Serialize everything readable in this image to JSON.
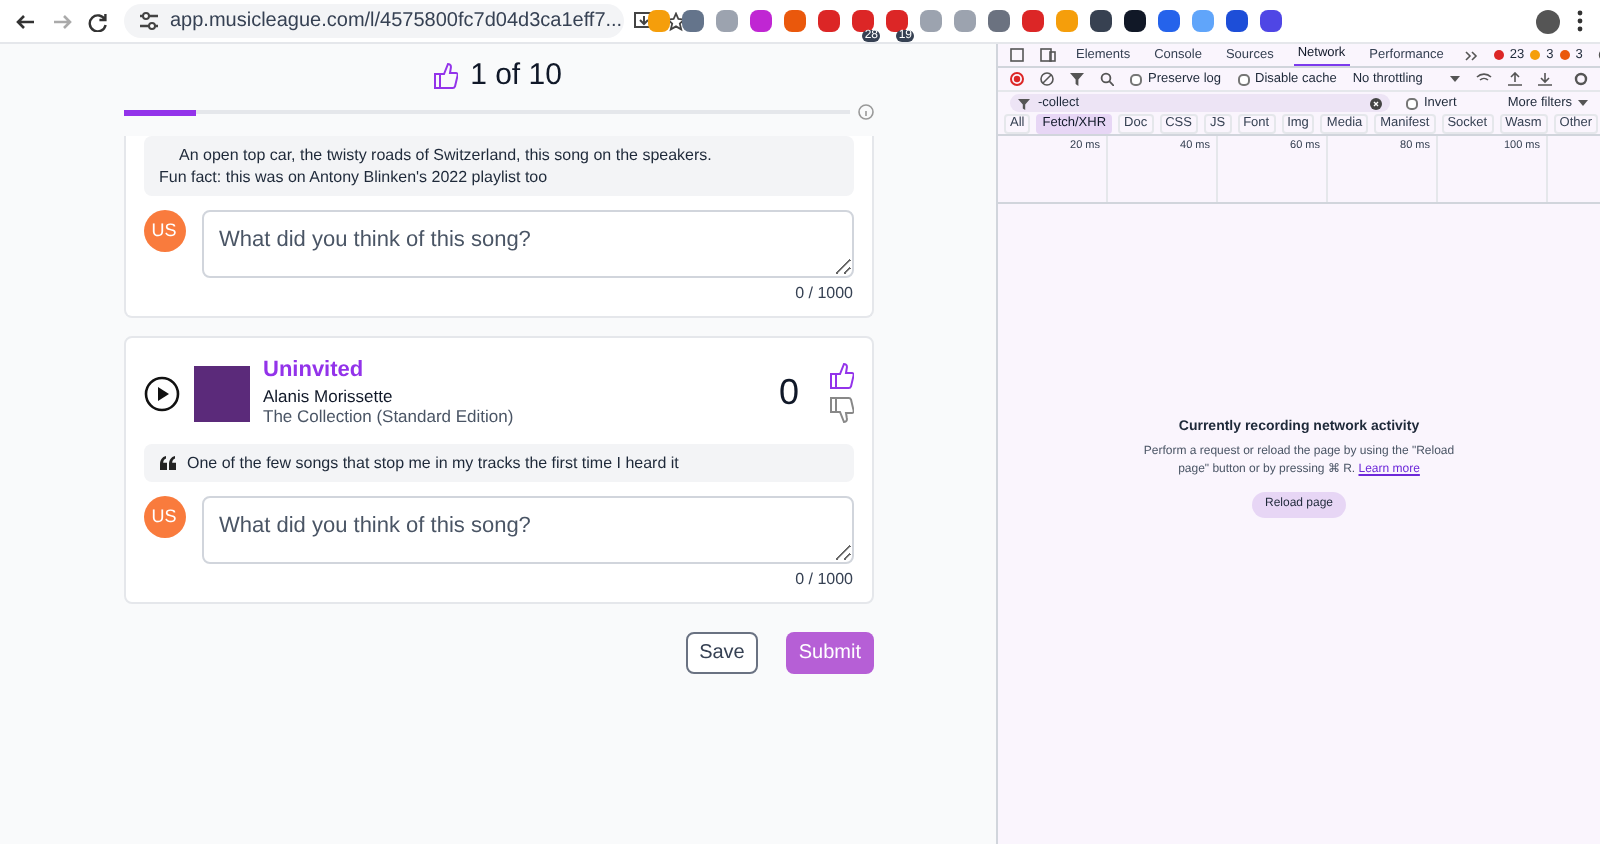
{
  "browser": {
    "url": "app.musicleague.com/l/4575800fc7d04d3ca1eff7...",
    "extensions": [
      {
        "color": "#f59e0b"
      },
      {
        "color": "#64748b"
      },
      {
        "color": "#9ca3af"
      },
      {
        "color": "#c026d3"
      },
      {
        "color": "#ea580c"
      },
      {
        "color": "#dc2626"
      },
      {
        "color": "#dc2626",
        "badge": "28"
      },
      {
        "color": "#dc2626",
        "badge": "19"
      },
      {
        "color": "#9ca3af"
      },
      {
        "color": "#9ca3af"
      },
      {
        "color": "#6b7280"
      },
      {
        "color": "#dc2626"
      },
      {
        "color": "#f59e0b"
      },
      {
        "color": "#374151"
      },
      {
        "color": "#111827"
      },
      {
        "color": "#2563eb"
      },
      {
        "color": "#60a5fa"
      },
      {
        "color": "#1d4ed8"
      },
      {
        "color": "#4f46e5"
      }
    ]
  },
  "header": {
    "progress": "1 of 10",
    "level": 0.1
  },
  "cards": [
    {
      "kind": "partial",
      "comment_lines": [
        "An open top car, the twisty roads of Switzerland, this song on the speakers.",
        "Fun fact: this was on Antony Blinken's 2022 playlist too"
      ],
      "avatar": "US",
      "placeholder": "What did you think of this song?",
      "counter": "0 / 1000"
    },
    {
      "kind": "song",
      "title": "Uninvited",
      "artist": "Alanis Morissette",
      "album": "The Collection (Standard Edition)",
      "votes": "0",
      "comment_lines": [
        "One of the few songs that stop me in my tracks the first time I heard it"
      ],
      "avatar": "US",
      "placeholder": "What did you think of this song?",
      "counter": "0 / 1000"
    }
  ],
  "actions": [
    {
      "label": "Save",
      "kind": "outline"
    },
    {
      "label": "Submit",
      "kind": "primary"
    }
  ],
  "devtools": {
    "tabs": [
      {
        "label": "Elements",
        "selected": false
      },
      {
        "label": "Console",
        "selected": false
      },
      {
        "label": "Sources",
        "selected": false
      },
      {
        "label": "Network",
        "selected": true
      },
      {
        "label": "Performance",
        "selected": false
      }
    ],
    "errors": "23",
    "warnings": "3",
    "issues": "3",
    "preserve_log": {
      "label": "Preserve log",
      "checked": false
    },
    "disable_cache": {
      "label": "Disable cache",
      "checked": false
    },
    "throttling": "No throttling",
    "filter": "-collect",
    "invert": {
      "label": "Invert",
      "checked": false
    },
    "more_filters": "More filters",
    "types": [
      {
        "label": "All",
        "selected": false
      },
      {
        "label": "Fetch/XHR",
        "selected": true
      },
      {
        "label": "Doc",
        "selected": false
      },
      {
        "label": "CSS",
        "selected": false
      },
      {
        "label": "JS",
        "selected": false
      },
      {
        "label": "Font",
        "selected": false
      },
      {
        "label": "Img",
        "selected": false
      },
      {
        "label": "Media",
        "selected": false
      },
      {
        "label": "Manifest",
        "selected": false
      },
      {
        "label": "Socket",
        "selected": false
      },
      {
        "label": "Wasm",
        "selected": false
      },
      {
        "label": "Other",
        "selected": false
      }
    ],
    "ticks": [
      "20 ms",
      "40 ms",
      "60 ms",
      "80 ms",
      "100 ms"
    ],
    "empty_title": "Currently recording network activity",
    "empty_text": "Perform a request or reload the page by using the \"Reload page\" button or by pressing ⌘ R.",
    "learn_more": "Learn more",
    "reload": "Reload page"
  }
}
